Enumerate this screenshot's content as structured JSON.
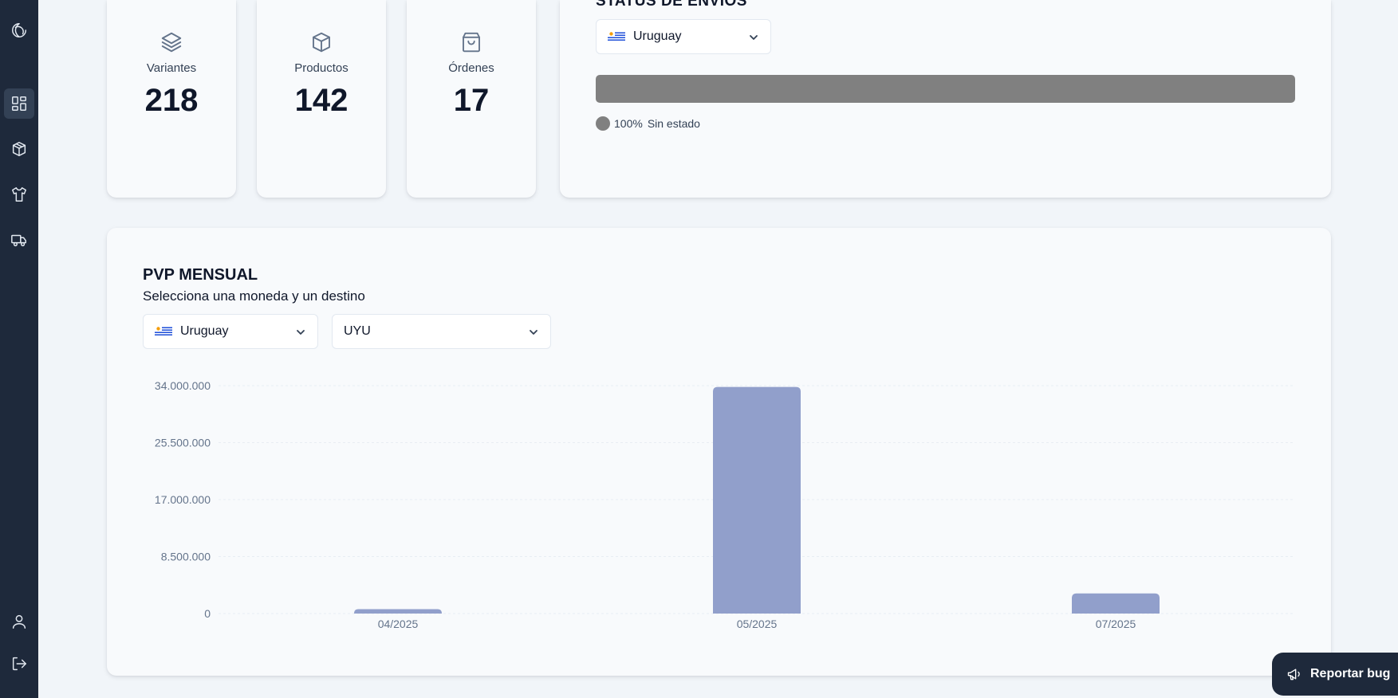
{
  "sidebar": {
    "items": [
      {
        "icon": "logo-icon"
      },
      {
        "icon": "dashboard-icon",
        "active": true
      },
      {
        "icon": "packages-icon"
      },
      {
        "icon": "shirt-icon"
      },
      {
        "icon": "truck-icon"
      },
      {
        "icon": "user-icon"
      },
      {
        "icon": "logout-icon"
      }
    ]
  },
  "stats": [
    {
      "label": "Variantes",
      "value": "218",
      "icon": "layers-icon"
    },
    {
      "label": "Productos",
      "value": "142",
      "icon": "box-icon"
    },
    {
      "label": "Órdenes",
      "value": "17",
      "icon": "shopping-bag-icon"
    }
  ],
  "status": {
    "title": "STATUS DE ENVIOS",
    "country_select": {
      "value": "Uruguay",
      "flag": "uruguay-flag"
    },
    "progress": {
      "percent": 100,
      "color": "#808080"
    },
    "legend": {
      "percent": "100%",
      "label": "Sin estado",
      "color": "#808080"
    }
  },
  "chart_section": {
    "title": "PVP MENSUAL",
    "subtitle": "Selecciona una moneda y un destino",
    "country_select": {
      "value": "Uruguay",
      "flag": "uruguay-flag"
    },
    "currency_select": {
      "value": "UYU"
    }
  },
  "chart_data": {
    "type": "bar",
    "categories": [
      "04/2025",
      "05/2025",
      "07/2025"
    ],
    "values": [
      650000,
      33800000,
      3000000
    ],
    "ylim": [
      0,
      34000000
    ],
    "yticks": [
      0,
      8500000,
      17000000,
      25500000,
      34000000
    ],
    "ytick_labels": [
      "0",
      "8.500.000",
      "17.000.000",
      "25.500.000",
      "34.000.000"
    ],
    "bar_color": "#919fcb",
    "grid": true
  },
  "bug_button": {
    "label": "Reportar bug"
  }
}
